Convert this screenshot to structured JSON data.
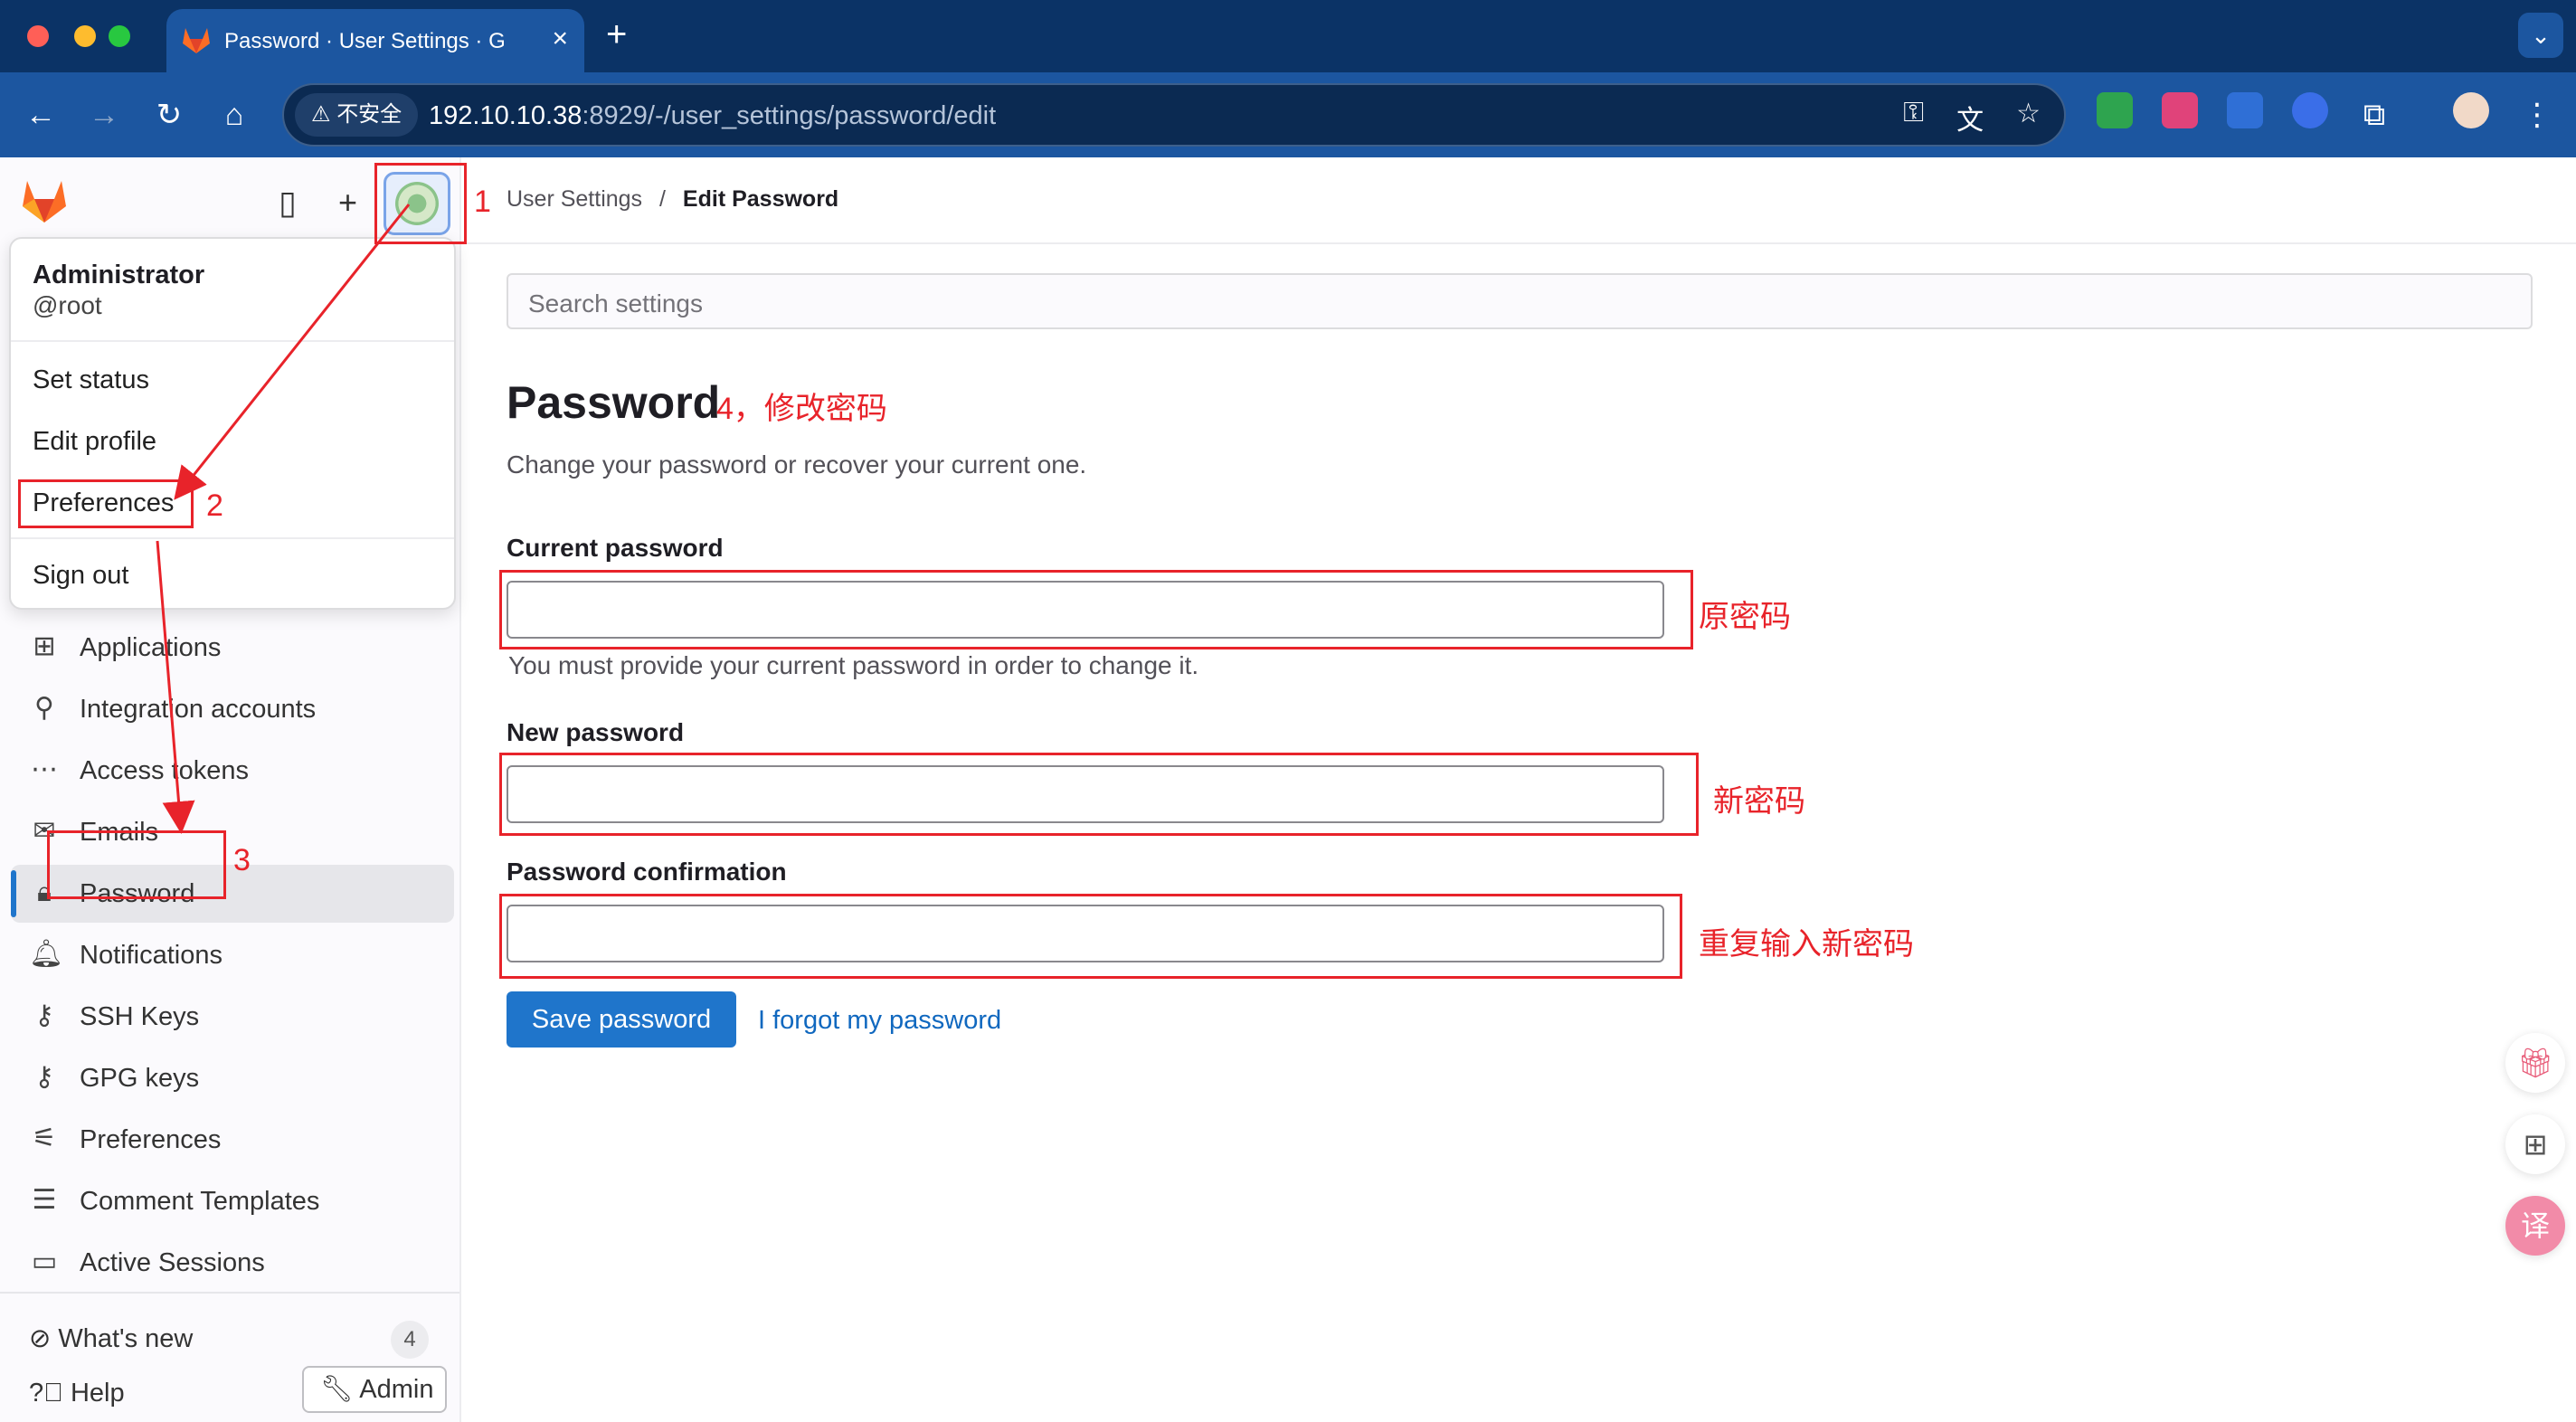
{
  "browser": {
    "tab_title": "Password · User Settings · G",
    "tab_close": "×",
    "new_tab": "+",
    "security_chip": "不安全",
    "url_host": "192.10.10.38",
    "url_path": ":8929/-/user_settings/password/edit"
  },
  "breadcrumb": {
    "parent": "User Settings",
    "separator": "/",
    "current": "Edit Password"
  },
  "sidebar": {
    "items": [
      {
        "label": "Applications",
        "icon": "applications-icon"
      },
      {
        "label": "Integration accounts",
        "icon": "plug-icon"
      },
      {
        "label": "Access tokens",
        "icon": "token-icon"
      },
      {
        "label": "Emails",
        "icon": "mail-icon"
      },
      {
        "label": "Password",
        "icon": "lock-icon",
        "active": true
      },
      {
        "label": "Notifications",
        "icon": "bell-icon"
      },
      {
        "label": "SSH Keys",
        "icon": "key-icon"
      },
      {
        "label": "GPG keys",
        "icon": "key-icon"
      },
      {
        "label": "Preferences",
        "icon": "preferences-icon"
      },
      {
        "label": "Comment Templates",
        "icon": "comment-icon"
      },
      {
        "label": "Active Sessions",
        "icon": "monitor-icon"
      }
    ],
    "whats_new": "What's new",
    "whats_new_count": "4",
    "help": "Help",
    "admin": "Admin"
  },
  "user_menu": {
    "name": "Administrator",
    "handle": "@root",
    "set_status": "Set status",
    "edit_profile": "Edit profile",
    "preferences": "Preferences",
    "sign_out": "Sign out"
  },
  "main": {
    "search_placeholder": "Search settings",
    "title": "Password",
    "description": "Change your password or recover your current one.",
    "current_label": "Current password",
    "current_help": "You must provide your current password in order to change it.",
    "new_label": "New password",
    "confirm_label": "Password confirmation",
    "save_button": "Save password",
    "forgot_link": "I forgot my password"
  },
  "annotations": {
    "step1": "1",
    "step2": "2",
    "step3": "3",
    "step4": "4，修改密码",
    "old_password": "原密码",
    "new_password": "新密码",
    "repeat_password": "重复输入新密码",
    "color": "#e8232a"
  },
  "colors": {
    "primary": "#1f75cb",
    "browser_bar": "#1c56a0"
  }
}
